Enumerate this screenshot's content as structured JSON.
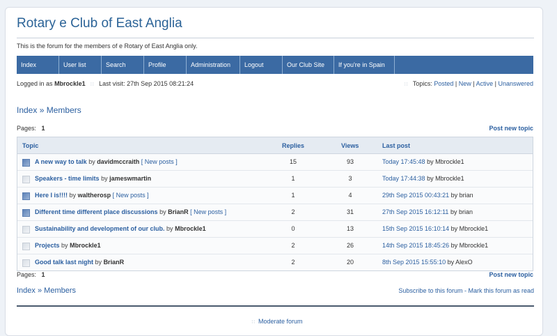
{
  "board": {
    "title": "Rotary e Club of East Anglia",
    "description": "This is the forum for the members of e Rotary of East Anglia only."
  },
  "nav": [
    "Index",
    "User list",
    "Search",
    "Profile",
    "Administration",
    "Logout",
    "Our Club Site",
    "If you're in Spain"
  ],
  "status": {
    "logged_in_prefix": "Logged in as",
    "username": "Mbrockle1",
    "last_visit": "Last visit: 27th Sep 2015 08:21:24",
    "topics_label": "Topics:",
    "topics_links": [
      "Posted",
      "New",
      "Active",
      "Unanswered"
    ]
  },
  "breadcrumb": {
    "index": "Index",
    "sep": "»",
    "current": "Members"
  },
  "pages": {
    "label": "Pages:",
    "current": "1",
    "post_new": "Post new topic"
  },
  "table": {
    "headers": {
      "topic": "Topic",
      "replies": "Replies",
      "views": "Views",
      "last_post": "Last post"
    },
    "rows": [
      {
        "icon": "newposts",
        "title": "A new way to talk",
        "by": "by",
        "author": "davidmccraith",
        "new_posts": "[ New posts ]",
        "replies": "15",
        "views": "93",
        "last_date": "Today 17:45:48",
        "last_by": "by Mbrockle1"
      },
      {
        "icon": "normal",
        "title": "Speakers - time limits",
        "by": "by",
        "author": "jameswmartin",
        "new_posts": "",
        "replies": "1",
        "views": "3",
        "last_date": "Today 17:44:38",
        "last_by": "by Mbrockle1"
      },
      {
        "icon": "newposts",
        "title": "Here I is!!!!",
        "by": "by",
        "author": "waltherosp",
        "new_posts": "[ New posts ]",
        "replies": "1",
        "views": "4",
        "last_date": "29th Sep 2015 00:43:21",
        "last_by": "by brian"
      },
      {
        "icon": "newposts",
        "title": "Different time different place discussions",
        "by": "by",
        "author": "BrianR",
        "new_posts": "[ New posts ]",
        "replies": "2",
        "views": "31",
        "last_date": "27th Sep 2015 16:12:11",
        "last_by": "by brian"
      },
      {
        "icon": "normal",
        "title": "Sustainability and development of our club.",
        "by": "by",
        "author": "Mbrockle1",
        "new_posts": "",
        "replies": "0",
        "views": "13",
        "last_date": "15th Sep 2015 16:10:14",
        "last_by": "by Mbrockle1"
      },
      {
        "icon": "normal",
        "title": "Projects",
        "by": "by",
        "author": "Mbrockle1",
        "new_posts": "",
        "replies": "2",
        "views": "26",
        "last_date": "14th Sep 2015 18:45:26",
        "last_by": "by Mbrockle1"
      },
      {
        "icon": "normal",
        "title": "Good talk last night",
        "by": "by",
        "author": "BrianR",
        "new_posts": "",
        "replies": "2",
        "views": "20",
        "last_date": "8th Sep 2015 15:55:10",
        "last_by": "by AlexO"
      }
    ]
  },
  "footer": {
    "subscribe": "Subscribe to this forum",
    "mark_read": "Mark this forum as read",
    "dash": " - ",
    "moderate": "Moderate forum"
  }
}
